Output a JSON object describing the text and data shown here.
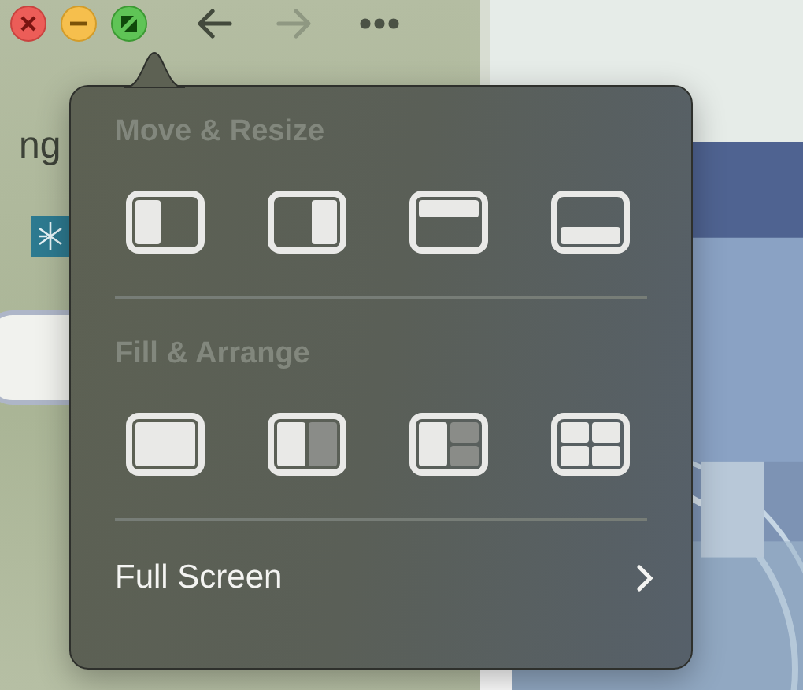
{
  "toolbar": {
    "nav": [
      {
        "kind": "back",
        "disabled": false
      },
      {
        "kind": "forward",
        "disabled": true
      }
    ]
  },
  "sidebar": {
    "text": "ng"
  },
  "popover": {
    "sections": [
      {
        "title": "Move & Resize",
        "layouts": [
          {
            "kind": "left"
          },
          {
            "kind": "right"
          },
          {
            "kind": "top"
          },
          {
            "kind": "bottom"
          }
        ]
      },
      {
        "title": "Fill & Arrange",
        "layouts": [
          {
            "kind": "full"
          },
          {
            "kind": "halves"
          },
          {
            "kind": "one-two"
          },
          {
            "kind": "quad"
          }
        ]
      }
    ],
    "footer": {
      "label": "Full Screen"
    }
  }
}
